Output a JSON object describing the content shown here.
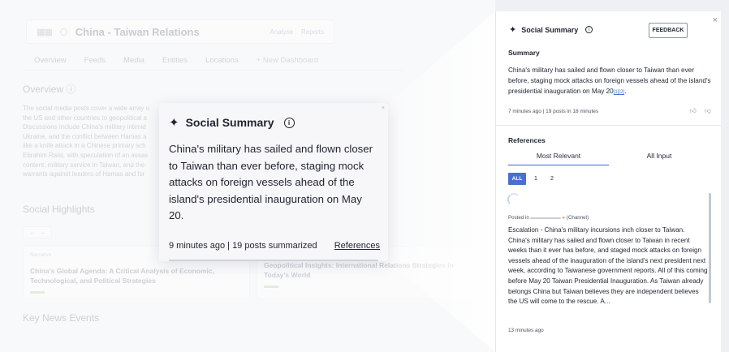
{
  "background": {
    "dashboard_title": "China - Taiwan Relations",
    "top_links": [
      "Analyse",
      "Reports"
    ],
    "tabs": [
      "Overview",
      "Feeds",
      "Media",
      "Entities",
      "Locations"
    ],
    "new_dashboard": "+ New Dashboard",
    "overview_title": "Overview",
    "overview_lines": [
      "The social media posts cover a wide array o",
      "the US and other countries to geopolitical a",
      "Discussions include China's military intimid",
      "Ukraine, and the conflict between Hamas a",
      "like a knife attack in a Chinese primary sch",
      "Ebrahim Raisi, with speculation of an assas",
      "content, military service in Taiwan, and the",
      "warrants against leaders of Hamas and Isr"
    ],
    "social_highlights_title": "Social Highlights",
    "arrows": [
      "←",
      "→"
    ],
    "highlight_cards": [
      {
        "label": "Narrative",
        "title": "China's Global Agenda: A Critical Analysis of Economic, Technological, and Political Strategies"
      },
      {
        "label": "",
        "title": "Geopolitical Insights: International Relations Strategies in Today's World"
      }
    ],
    "key_news_title": "Key News Events"
  },
  "popup": {
    "title": "Social Summary",
    "body": "China's military has sailed and flown closer to Taiwan than ever before, staging mock attacks on foreign vessels ahead of the island's presidential inauguration on May 20.",
    "meta": "9 minutes ago | 19 posts summarized",
    "references_link": "References"
  },
  "panel": {
    "title": "Social Summary",
    "feedback_label": "FEEDBACK",
    "close_glyph": "×",
    "summary_title": "Summary",
    "summary_text": "China's military has sailed and flown closer to Taiwan than ever before, staging mock attacks on foreign vessels ahead of the island's presidential inauguration on May 20",
    "summary_citation": "[1][2]",
    "summary_meta": "7 minutes ago | 19 posts in 18 minutes",
    "references_title": "References",
    "ref_tabs": [
      "Most Relevant",
      "All Input"
    ],
    "pages": [
      "ALL",
      "1",
      "2"
    ],
    "post": {
      "posted_prefix": "Posted in",
      "posted_suffix": "(Channel)",
      "text": "Escalation - China's military incursions inch closer to Taiwan.  China's military has sailed and flown closer to Taiwan in recent weeks than it ever has before, and staged mock attacks on foreign vessels ahead of the inauguration of the island's next president next week, according to Taiwanese government reports.  All of this coming before May 20 Taiwan Presidential Inauguration.  As Taiwan already belongs China but Taiwan believes they are independent believes the US will come to the rescue.  A...",
      "time": "13 minutes ago"
    }
  },
  "colors": {
    "accent": "#4a6fd0",
    "narrative_bar": "#8ac06e"
  }
}
